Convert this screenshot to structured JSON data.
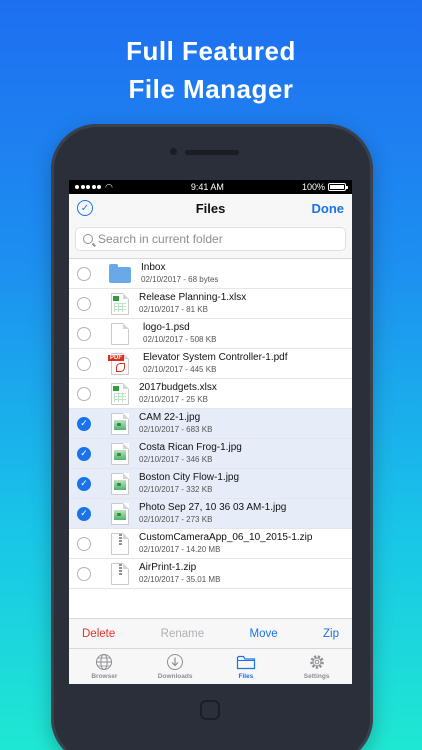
{
  "headline": {
    "line1": "Full Featured",
    "line2": "File Manager"
  },
  "status_bar": {
    "time": "9:41 AM",
    "battery": "100%",
    "signal_icon": "signal-dots-icon",
    "wifi_icon": "wifi-icon"
  },
  "nav": {
    "title": "Files",
    "done_label": "Done",
    "select_icon": "checkmark-circle-icon"
  },
  "search": {
    "placeholder": "Search in current folder"
  },
  "files": [
    {
      "name": "Inbox",
      "date": "02/10/2017",
      "size": "68 bytes",
      "type": "folder",
      "selected": false
    },
    {
      "name": "Release Planning-1.xlsx",
      "date": "02/10/2017",
      "size": "81 KB",
      "type": "xlsx",
      "selected": false
    },
    {
      "name": "logo-1.psd",
      "date": "02/10/2017",
      "size": "508 KB",
      "type": "psd",
      "selected": false
    },
    {
      "name": "Elevator System Controller-1.pdf",
      "date": "02/10/2017",
      "size": "445 KB",
      "type": "pdf",
      "selected": false
    },
    {
      "name": "2017budgets.xlsx",
      "date": "02/10/2017",
      "size": "25 KB",
      "type": "xlsx",
      "selected": false
    },
    {
      "name": "CAM 22-1.jpg",
      "date": "02/10/2017",
      "size": "683 KB",
      "type": "jpg",
      "selected": true
    },
    {
      "name": "Costa Rican Frog-1.jpg",
      "date": "02/10/2017",
      "size": "346 KB",
      "type": "jpg",
      "selected": true
    },
    {
      "name": "Boston City Flow-1.jpg",
      "date": "02/10/2017",
      "size": "332 KB",
      "type": "jpg",
      "selected": true
    },
    {
      "name": "Photo Sep 27, 10 36 03 AM-1.jpg",
      "date": "02/10/2017",
      "size": "273 KB",
      "type": "jpg",
      "selected": true
    },
    {
      "name": "CustomCameraApp_06_10_2015-1.zip",
      "date": "02/10/2017",
      "size": "14.20 MB",
      "type": "zip",
      "selected": false
    },
    {
      "name": "AirPrint-1.zip",
      "date": "02/10/2017",
      "size": "35.01 MB",
      "type": "zip",
      "selected": false
    }
  ],
  "meta_separator": " - ",
  "pdf_badge": "PDF",
  "toolbar": {
    "delete": "Delete",
    "rename": "Rename",
    "move": "Move",
    "zip": "Zip"
  },
  "tabs": [
    {
      "label": "Browser",
      "icon": "globe-icon",
      "active": false
    },
    {
      "label": "Downloads",
      "icon": "download-icon",
      "active": false
    },
    {
      "label": "Files",
      "icon": "folder-icon",
      "active": true
    },
    {
      "label": "Settings",
      "icon": "gear-icon",
      "active": false
    }
  ],
  "colors": {
    "accent": "#1a73e8",
    "destructive": "#e5322d",
    "selected_row": "#e6edf8",
    "background_top": "#1e6ff0",
    "background_bottom": "#1fe8d2"
  }
}
